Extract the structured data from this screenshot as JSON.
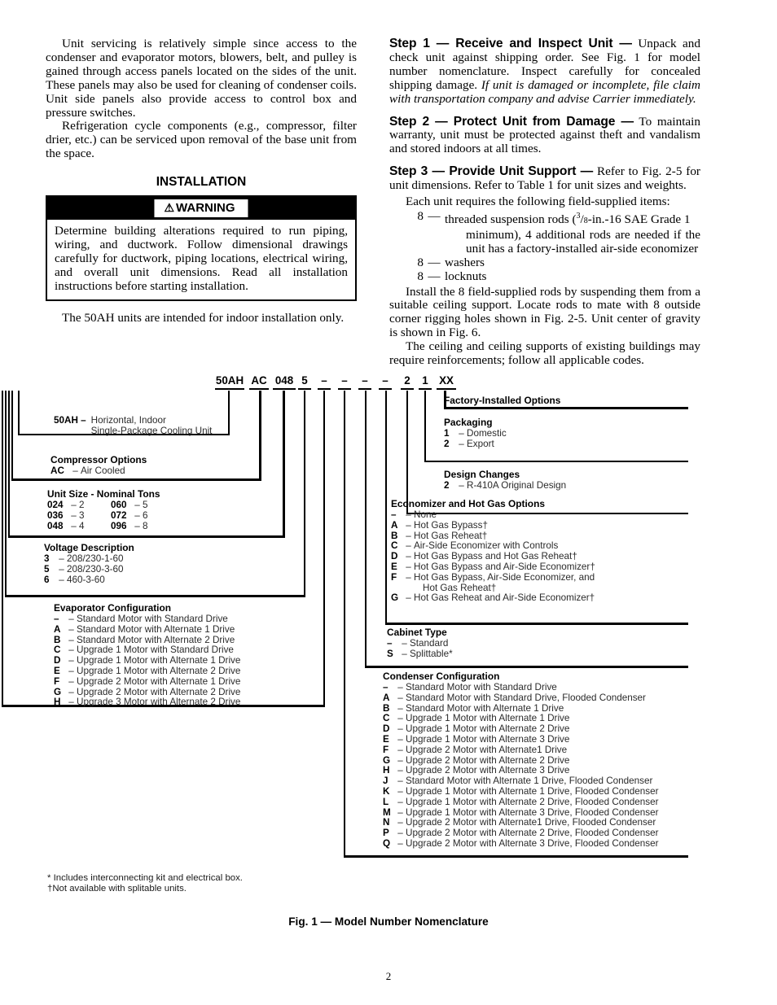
{
  "left_column": {
    "paragraphs": [
      "Unit servicing is relatively simple since access to the condenser and evaporator motors, blowers, belt, and pulley is gained through access panels located on the sides of the unit. These panels may also be used for cleaning of condenser coils. Unit side panels also provide access to control box and pressure switches.",
      "Refrigeration cycle components (e.g., compressor, filter drier, etc.) can be serviced upon removal of the base unit from the space."
    ],
    "section_title": "INSTALLATION",
    "warning": {
      "triangle_icon": "⚠",
      "label": "WARNING",
      "text": "Determine building alterations required to run piping, wiring, and ductwork. Follow dimensional drawings carefully for ductwork, piping locations, electrical wiring, and overall unit dimensions. Read all installation instructions before starting installation."
    },
    "after_warning": "The 50AH units are intended for indoor installation only."
  },
  "right_column": {
    "steps": [
      {
        "head": "Step 1 — Receive and Inspect Unit —",
        "body_plain": " Unpack and check unit against shipping order. See Fig. 1 for model number nomenclature. Inspect carefully for concealed shipping damage. ",
        "body_italic": "If unit is damaged or incomplete, file claim with transportation company and advise Carrier immediately."
      },
      {
        "head": "Step 2 — Protect Unit from Damage —",
        "body_plain": " To maintain warranty, unit must be protected against theft and vandalism and stored indoors at all times.",
        "body_italic": ""
      },
      {
        "head": "Step 3 — Provide Unit Support —",
        "body_plain": " Refer to Fig. 2-5 for unit dimensions. Refer to Table 1 for unit sizes and weights.",
        "body_italic": ""
      }
    ],
    "field_supplied_intro": "Each unit requires the following field-supplied items:",
    "field_supplied_items": [
      {
        "qty": "8",
        "dash": "—",
        "text_a": "threaded suspension rods (",
        "frac_num": "3",
        "frac_den": "8",
        "text_b": "-in.-16 SAE Grade 1",
        "text_cont": "minimum), 4 additional rods are needed if the unit has a factory-installed air-side economizer"
      },
      {
        "qty": "8",
        "dash": "—",
        "text_a": "washers",
        "frac_num": "",
        "frac_den": "",
        "text_b": "",
        "text_cont": ""
      },
      {
        "qty": "8",
        "dash": "—",
        "text_a": "locknuts",
        "frac_num": "",
        "frac_den": "",
        "text_b": "",
        "text_cont": ""
      }
    ],
    "closing_paragraphs": [
      "Install the 8 field-supplied rods by suspending them from a suitable ceiling support. Locate rods to mate with 8 outside corner rigging holes shown in Fig. 2-5. Unit center of gravity is shown in Fig. 6.",
      "The ceiling and ceiling supports of existing buildings may require reinforcements; follow all applicable codes."
    ]
  },
  "nomenclature": {
    "code_segments": [
      {
        "text": "50AH"
      },
      {
        "text": "AC"
      },
      {
        "text": "048"
      },
      {
        "text": "5"
      },
      {
        "text": "–"
      },
      {
        "text": "–"
      },
      {
        "text": "–"
      },
      {
        "text": "–"
      },
      {
        "text": "2"
      },
      {
        "text": "1"
      },
      {
        "text": "XX"
      }
    ],
    "blocks": {
      "model": {
        "key": "50AH –",
        "line1": "Horizontal, Indoor",
        "line2": "Single-Package Cooling Unit"
      },
      "compressor": {
        "title": "Compressor Options",
        "options": [
          {
            "k": "AC",
            "d": "–",
            "v": "Air Cooled"
          }
        ]
      },
      "unit_size": {
        "title": "Unit Size - Nominal Tons",
        "col1": [
          {
            "k": "024",
            "d": "–",
            "v": "2"
          },
          {
            "k": "036",
            "d": "–",
            "v": "3"
          },
          {
            "k": "048",
            "d": "–",
            "v": "4"
          }
        ],
        "col2": [
          {
            "k": "060",
            "d": "–",
            "v": "5"
          },
          {
            "k": "072",
            "d": "–",
            "v": "6"
          },
          {
            "k": "096",
            "d": "–",
            "v": "8"
          }
        ]
      },
      "voltage": {
        "title": "Voltage Description",
        "options": [
          {
            "k": "3",
            "d": "–",
            "v": "208/230-1-60"
          },
          {
            "k": "5",
            "d": "–",
            "v": "208/230-3-60"
          },
          {
            "k": "6",
            "d": "–",
            "v": "460-3-60"
          }
        ]
      },
      "evaporator": {
        "title": "Evaporator Configuration",
        "options": [
          {
            "k": "–",
            "d": "–",
            "v": "Standard Motor with Standard Drive"
          },
          {
            "k": "A",
            "d": "–",
            "v": "Standard Motor with Alternate 1 Drive"
          },
          {
            "k": "B",
            "d": "–",
            "v": "Standard Motor with Alternate 2 Drive"
          },
          {
            "k": "C",
            "d": "–",
            "v": "Upgrade 1 Motor with Standard Drive"
          },
          {
            "k": "D",
            "d": "–",
            "v": "Upgrade 1 Motor with Alternate 1 Drive"
          },
          {
            "k": "E",
            "d": "–",
            "v": "Upgrade 1 Motor with Alternate 2 Drive"
          },
          {
            "k": "F",
            "d": "–",
            "v": "Upgrade 2 Motor with Alternate 1 Drive"
          },
          {
            "k": "G",
            "d": "–",
            "v": "Upgrade 2 Motor with Alternate 2 Drive"
          },
          {
            "k": "H",
            "d": "–",
            "v": "Upgrade 3 Motor with Alternate 2 Drive"
          }
        ]
      },
      "factory_installed": {
        "title": "Factory-Installed Options"
      },
      "packaging": {
        "title": "Packaging",
        "options": [
          {
            "k": "1",
            "d": "–",
            "v": "Domestic"
          },
          {
            "k": "2",
            "d": "–",
            "v": "Export"
          }
        ]
      },
      "design_changes": {
        "title": "Design Changes",
        "options": [
          {
            "k": "2",
            "d": "–",
            "v": "R-410A Original Design"
          }
        ]
      },
      "economizer": {
        "title": "Economizer and Hot Gas Options",
        "options": [
          {
            "k": "–",
            "d": "–",
            "v": "None",
            "cont": ""
          },
          {
            "k": "A",
            "d": "–",
            "v": "Hot Gas Bypass†",
            "cont": ""
          },
          {
            "k": "B",
            "d": "–",
            "v": "Hot Gas Reheat†",
            "cont": ""
          },
          {
            "k": "C",
            "d": "–",
            "v": "Air-Side Economizer with Controls",
            "cont": ""
          },
          {
            "k": "D",
            "d": "–",
            "v": "Hot Gas Bypass and Hot Gas Reheat†",
            "cont": ""
          },
          {
            "k": "E",
            "d": "–",
            "v": "Hot Gas Bypass and Air-Side Economizer†",
            "cont": ""
          },
          {
            "k": "F",
            "d": "–",
            "v": "Hot Gas Bypass, Air-Side Economizer, and",
            "cont": "Hot Gas Reheat†"
          },
          {
            "k": "G",
            "d": "–",
            "v": "Hot Gas Reheat and Air-Side Economizer†",
            "cont": ""
          }
        ]
      },
      "cabinet": {
        "title": "Cabinet Type",
        "options": [
          {
            "k": "–",
            "d": "–",
            "v": "Standard"
          },
          {
            "k": "S",
            "d": "–",
            "v": "Splittable*"
          }
        ]
      },
      "condenser": {
        "title": "Condenser Configuration",
        "options": [
          {
            "k": "–",
            "d": "–",
            "v": "Standard Motor with Standard Drive"
          },
          {
            "k": "A",
            "d": "–",
            "v": "Standard Motor with Standard Drive, Flooded Condenser"
          },
          {
            "k": "B",
            "d": "–",
            "v": "Standard Motor with Alternate 1 Drive"
          },
          {
            "k": "C",
            "d": "–",
            "v": "Upgrade 1 Motor with Alternate 1 Drive"
          },
          {
            "k": "D",
            "d": "–",
            "v": "Upgrade 1 Motor with Alternate 2 Drive"
          },
          {
            "k": "E",
            "d": "–",
            "v": "Upgrade 1 Motor with Alternate 3 Drive"
          },
          {
            "k": "F",
            "d": "–",
            "v": "Upgrade 2 Motor with Alternate1 Drive"
          },
          {
            "k": "G",
            "d": "–",
            "v": "Upgrade 2 Motor with Alternate 2 Drive"
          },
          {
            "k": "H",
            "d": "–",
            "v": "Upgrade 2 Motor with Alternate 3 Drive"
          },
          {
            "k": "J",
            "d": "–",
            "v": "Standard Motor with Alternate 1 Drive, Flooded Condenser"
          },
          {
            "k": "K",
            "d": "–",
            "v": "Upgrade 1 Motor with Alternate 1 Drive, Flooded Condenser"
          },
          {
            "k": "L",
            "d": "–",
            "v": "Upgrade 1 Motor with Alternate 2 Drive, Flooded Condenser"
          },
          {
            "k": "M",
            "d": "–",
            "v": "Upgrade 1 Motor with Alternate 3 Drive, Flooded Condenser"
          },
          {
            "k": "N",
            "d": "–",
            "v": "Upgrade 2 Motor with Alternate1 Drive, Flooded Condenser"
          },
          {
            "k": "P",
            "d": "–",
            "v": "Upgrade 2 Motor with Alternate 2 Drive, Flooded Condenser"
          },
          {
            "k": "Q",
            "d": "–",
            "v": "Upgrade 2 Motor with Alternate 3 Drive, Flooded Condenser"
          }
        ]
      }
    }
  },
  "footnotes": {
    "line1": "* Includes interconnecting kit and electrical box.",
    "line2": "†Not available with splitable units."
  },
  "figure_caption": "Fig. 1 — Model Number Nomenclature",
  "page_number": "2"
}
